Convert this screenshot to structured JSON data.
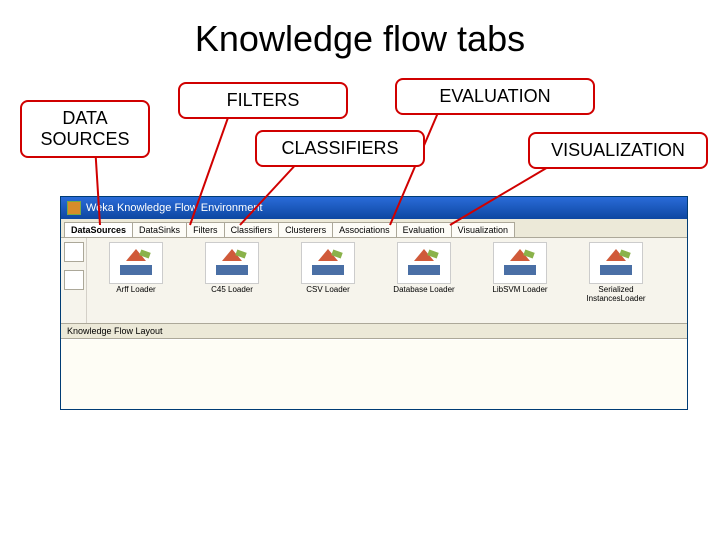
{
  "title": "Knowledge flow tabs",
  "callouts": {
    "data_sources": "DATA SOURCES",
    "filters": "FILTERS",
    "classifiers": "CLASSIFIERS",
    "evaluation": "EVALUATION",
    "visualization": "VISUALIZATION"
  },
  "window": {
    "title": "Weka Knowledge Flow Environment",
    "tabs": [
      "DataSources",
      "DataSinks",
      "Filters",
      "Classifiers",
      "Clusterers",
      "Associations",
      "Evaluation",
      "Visualization"
    ],
    "items": [
      "Arff Loader",
      "C45 Loader",
      "CSV Loader",
      "Database Loader",
      "LibSVM Loader",
      "Serialized InstancesLoader"
    ],
    "layout_label": "Knowledge Flow Layout"
  }
}
